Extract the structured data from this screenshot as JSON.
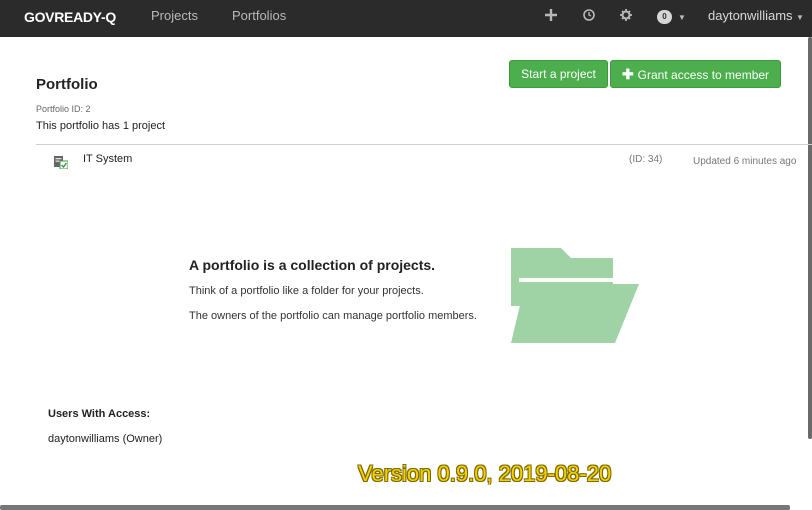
{
  "navbar": {
    "brand": "GOVREADY-Q",
    "links": [
      "Projects",
      "Portfolios"
    ],
    "icons": [
      "plus-icon",
      "clock-icon",
      "gear-icon"
    ],
    "notification_count": "0",
    "username": "daytonwilliams"
  },
  "portfolio": {
    "title": "Portfolio",
    "id_text": "Portfolio ID: 2",
    "count_text": "This portfolio has 1 project"
  },
  "buttons": {
    "start_project": "Start a project",
    "grant_access": "Grant access to member"
  },
  "projects": [
    {
      "name": "IT System",
      "id": "(ID: 34)",
      "updated": "Updated 6 minutes ago"
    }
  ],
  "explanation": {
    "heading": "A portfolio is a collection of projects.",
    "p1": "Think of a portfolio like a folder for your projects.",
    "p2": "The owners of the portfolio can manage portfolio members."
  },
  "users": {
    "heading": "Users With Access:",
    "list": [
      "daytonwilliams (Owner)"
    ]
  },
  "version": "Version 0.9.0, 2019-08-20",
  "colors": {
    "navbar": "#2b2b2b",
    "button": "#4cae4c",
    "folder": "#9fd3a5",
    "version": "#f5d000"
  }
}
